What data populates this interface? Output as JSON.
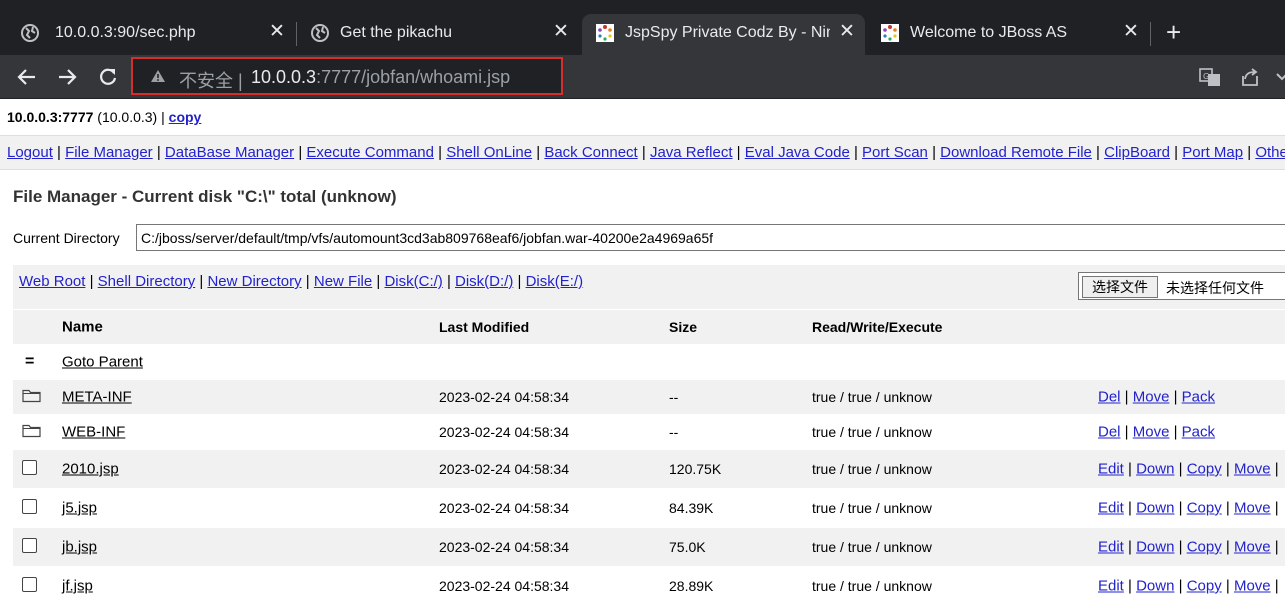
{
  "browser": {
    "tabs": [
      {
        "title": "10.0.0.3:90/sec.php",
        "icon": "globe-icon"
      },
      {
        "title": "Get the pikachu",
        "icon": "globe-icon"
      },
      {
        "title": "JspSpy Private Codz By - Nin",
        "icon": "jboss-favicon",
        "active": true
      },
      {
        "title": "Welcome to JBoss AS",
        "icon": "jboss-favicon"
      }
    ],
    "new_tab": "+",
    "close": "✕",
    "security_text": "不安全",
    "separator": "|",
    "url_host": "10.0.0.3",
    "url_rest": ":7777/jobfan/whoami.jsp"
  },
  "page": {
    "host_bold": "10.0.0.3:7777",
    "host_ip": "(10.0.0.3)",
    "host_sep": "|",
    "copy_label": "copy",
    "menu": [
      "Logout",
      "File Manager",
      "DataBase Manager",
      "Execute Command",
      "Shell OnLine",
      "Back Connect",
      "Java Reflect",
      "Eval Java Code",
      "Port Scan",
      "Download Remote File",
      "ClipBoard",
      "Port Map",
      "Others"
    ],
    "fm_title": "File Manager - Current disk \"C:\\\" total (unknow)",
    "current_dir_label": "Current Directory",
    "current_dir_value": "C:/jboss/server/default/tmp/vfs/automount3cd3ab809768eaf6/jobfan.war-40200e2a4969a65f",
    "quick_links": [
      "Web Root",
      "Shell Directory",
      "New Directory",
      "New File",
      "Disk(C:/)",
      "Disk(D:/)",
      "Disk(E:/)"
    ],
    "file_picker": {
      "button": "选择文件",
      "status": "未选择任何文件"
    },
    "table": {
      "headers": {
        "name": "Name",
        "modified": "Last Modified",
        "size": "Size",
        "rwx": "Read/Write/Execute"
      },
      "parent": {
        "icon": "=",
        "label": "Goto Parent"
      },
      "rows": [
        {
          "type": "folder",
          "name": "META-INF",
          "modified": "2023-02-24 04:58:34",
          "size": "--",
          "rwx": "true / true / unknow",
          "actions": [
            "Del",
            "Move",
            "Pack"
          ]
        },
        {
          "type": "folder",
          "name": "WEB-INF",
          "modified": "2023-02-24 04:58:34",
          "size": "--",
          "rwx": "true / true / unknow",
          "actions": [
            "Del",
            "Move",
            "Pack"
          ]
        },
        {
          "type": "file",
          "name": "2010.jsp",
          "modified": "2023-02-24 04:58:34",
          "size": "120.75K",
          "rwx": "true / true / unknow",
          "actions": [
            "Edit",
            "Down",
            "Copy",
            "Move"
          ]
        },
        {
          "type": "file",
          "name": "j5.jsp",
          "modified": "2023-02-24 04:58:34",
          "size": "84.39K",
          "rwx": "true / true / unknow",
          "actions": [
            "Edit",
            "Down",
            "Copy",
            "Move"
          ]
        },
        {
          "type": "file",
          "name": "jb.jsp",
          "modified": "2023-02-24 04:58:34",
          "size": "75.0K",
          "rwx": "true / true / unknow",
          "actions": [
            "Edit",
            "Down",
            "Copy",
            "Move"
          ]
        },
        {
          "type": "file",
          "name": "jf.jsp",
          "modified": "2023-02-24 04:58:34",
          "size": "28.89K",
          "rwx": "true / true / unknow",
          "actions": [
            "Edit",
            "Down",
            "Copy",
            "Move"
          ]
        }
      ]
    }
  },
  "colors": {
    "link": "#2222cc",
    "highlight_box": "#d62d2d",
    "chrome_dark": "#202124",
    "chrome_toolbar": "#35363a",
    "row_alt": "#f1f1f1"
  }
}
